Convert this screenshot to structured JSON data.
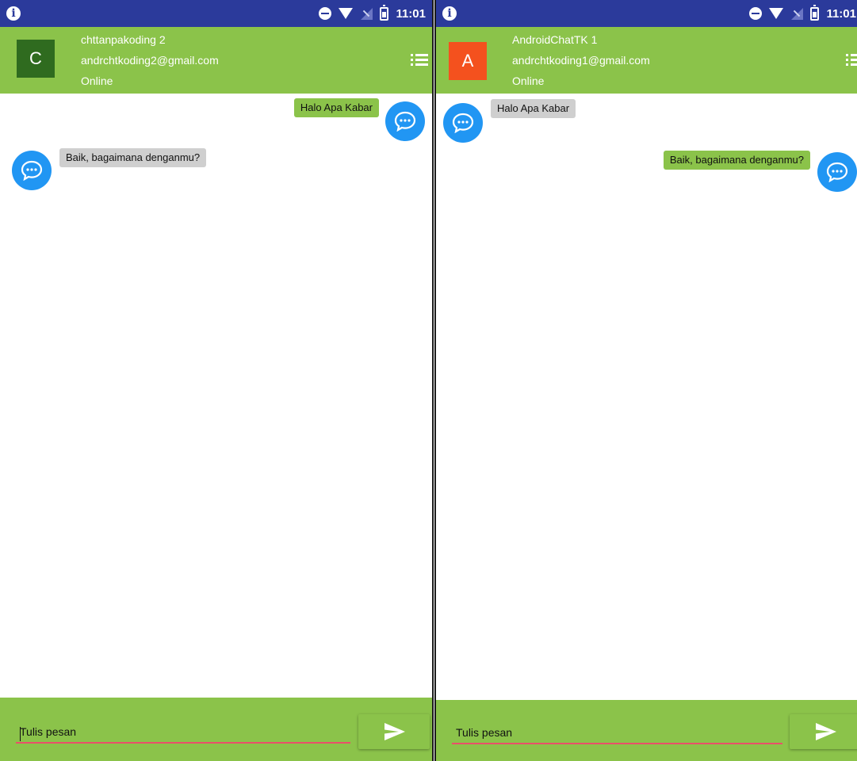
{
  "status_bar": {
    "time": "11:01"
  },
  "left_phone": {
    "header": {
      "avatar_letter": "C",
      "avatar_color": "#2f6b1f",
      "name": "chttanpakoding 2",
      "email": "andrchtkoding2@gmail.com",
      "status": "Online"
    },
    "messages": [
      {
        "text": "Halo Apa Kabar",
        "direction": "sent"
      },
      {
        "text": "Baik, bagaimana denganmu?",
        "direction": "received"
      }
    ],
    "composer": {
      "placeholder": "Tulis pesan"
    }
  },
  "right_phone": {
    "header": {
      "avatar_letter": "A",
      "avatar_color": "#f4511e",
      "name": "AndroidChatTK 1",
      "email": "andrchtkoding1@gmail.com",
      "status": "Online"
    },
    "messages": [
      {
        "text": "Halo Apa Kabar",
        "direction": "received"
      },
      {
        "text": "Baik, bagaimana denganmu?",
        "direction": "sent"
      }
    ],
    "composer": {
      "placeholder": "Tulis pesan"
    }
  },
  "colors": {
    "status_bar": "#2b3a9b",
    "app_bar": "#8bc34a",
    "sent_bubble": "#8bc34a",
    "received_bubble": "#cfcfcf",
    "chat_icon": "#2196f3",
    "input_underline": "#e9506a"
  },
  "icons": {
    "status_left": "info-icon",
    "status_right": [
      "dnd-icon",
      "wifi-icon",
      "signal-icon",
      "battery-icon"
    ],
    "header_action": "menu-list-icon",
    "message_avatar": "chat-bubble-icon",
    "send": "send-icon"
  }
}
